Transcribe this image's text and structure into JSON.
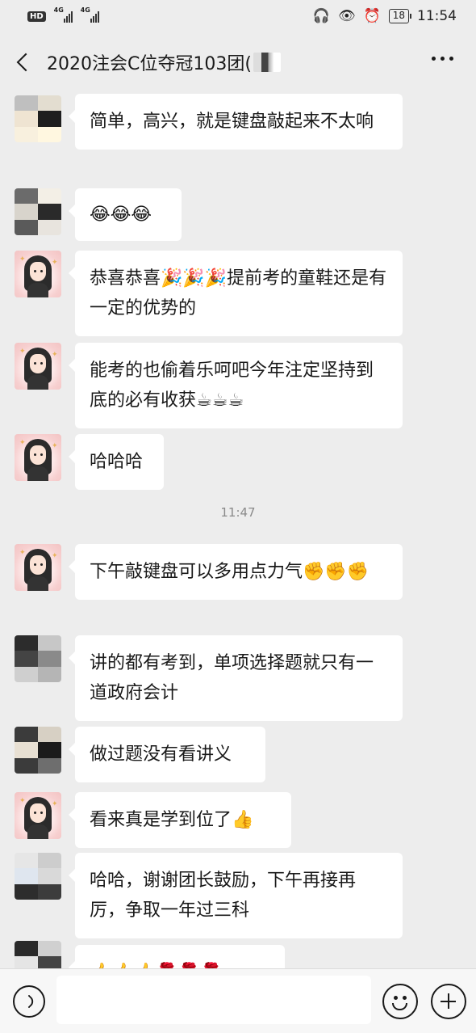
{
  "status_bar": {
    "hd_badge": "HD",
    "network_1": "4G",
    "network_2": "4G",
    "battery": "18",
    "time": "11:54"
  },
  "header": {
    "title": "2020注会C位夺冠103团(",
    "more_icon": "more-dots-icon",
    "back_icon": "chevron-left-icon"
  },
  "messages": [
    {
      "text": "简单，高兴，就是键盘敲起来不太响"
    },
    {
      "text": "😂😂😂"
    },
    {
      "text": "恭喜恭喜🎉🎉🎉提前考的童鞋还是有一定的优势的"
    },
    {
      "text": "能考的也偷着乐呵吧今年注定坚持到底的必有收获☕☕☕"
    },
    {
      "text": "哈哈哈"
    },
    {
      "text": "下午敲键盘可以多用点力气✊✊✊"
    },
    {
      "text": "讲的都有考到，单项选择题就只有一道政府会计"
    },
    {
      "text": "做过题没有看讲义"
    },
    {
      "text": "看来真是学到位了👍"
    },
    {
      "text": "哈哈，谢谢团长鼓励，下午再接再厉，争取一年过三科"
    },
    {
      "text": "👍👍👍🌹🌹🌹"
    }
  ],
  "time_separator": "11:47",
  "input_bar": {
    "voice_icon": "voice-icon",
    "emoji_icon": "emoji-icon",
    "plus_icon": "plus-icon"
  }
}
